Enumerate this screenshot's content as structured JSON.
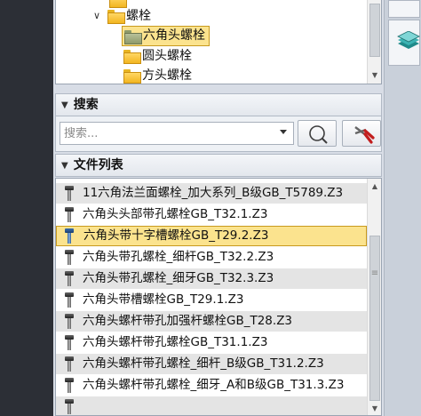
{
  "tree": {
    "items": [
      {
        "label": "螺栓",
        "expanded": true
      },
      {
        "label": "六角头螺栓",
        "selected": true
      },
      {
        "label": "圆头螺栓"
      },
      {
        "label": "方头螺栓"
      }
    ]
  },
  "search_section": {
    "title": "搜索",
    "placeholder": "搜索..."
  },
  "file_list": {
    "title": "文件列表",
    "items": [
      "11六角法兰面螺栓_加大系列_B级GB_T5789.Z3",
      "六角头头部带孔螺栓GB_T32.1.Z3",
      "六角头带十字槽螺栓GB_T29.2.Z3",
      "六角头带孔螺栓_细杆GB_T32.2.Z3",
      "六角头带孔螺栓_细牙GB_T32.3.Z3",
      "六角头带槽螺栓GB_T29.1.Z3",
      "六角头螺杆带孔加强杆螺栓GB_T28.Z3",
      "六角头螺杆带孔螺栓GB_T31.1.Z3",
      "六角头螺杆带孔螺栓_细杆_B级GB_T31.2.Z3",
      "六角头螺杆带孔螺栓_细牙_A和B级GB_T31.3.Z3"
    ],
    "selected_index": 2
  },
  "colors": {
    "selection": "#fbe38e",
    "selection_border": "#c89a1e",
    "dark_gutter": "#2c2f36"
  }
}
